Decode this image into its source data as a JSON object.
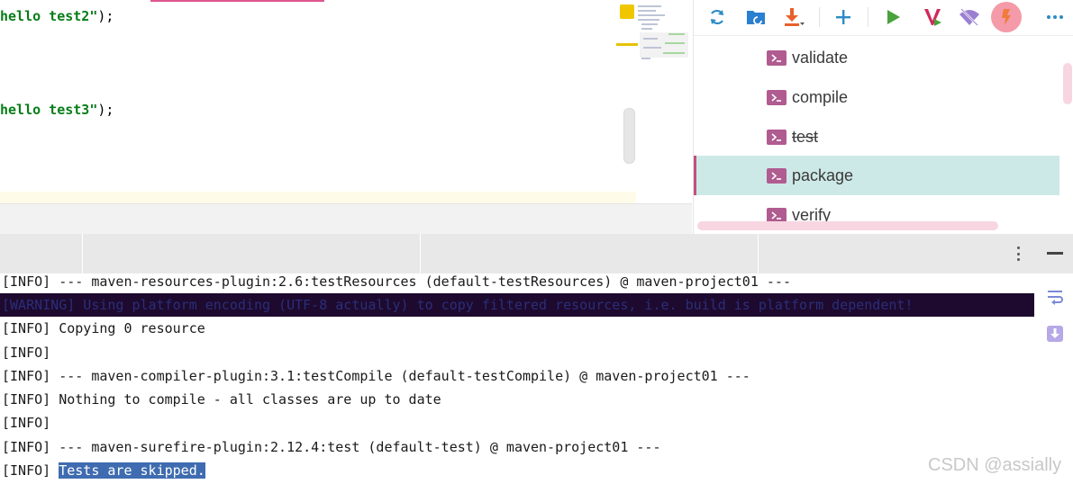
{
  "editor": {
    "lines": [
      {
        "string": "hello test2\"",
        "rest": ");"
      },
      {
        "string": "hello test3\"",
        "rest": ");"
      }
    ]
  },
  "maven": {
    "toolbar": {
      "reload": "reload-icon",
      "generate_sources": "folder-sync-icon",
      "download": "download-icon",
      "add": "plus-icon",
      "run": "play-icon",
      "execute_goal": "maven-v-icon",
      "offline": "wifi-off-icon",
      "skip_tests": "lightning-icon",
      "more": "more-horizontal-icon"
    },
    "goals": [
      {
        "label": "validate",
        "strike": false,
        "selected": false
      },
      {
        "label": "compile",
        "strike": false,
        "selected": false
      },
      {
        "label": "test",
        "strike": true,
        "selected": false
      },
      {
        "label": "package",
        "strike": false,
        "selected": true
      },
      {
        "label": "verify",
        "strike": false,
        "selected": false
      }
    ]
  },
  "console": {
    "lines": [
      "[INFO] --- maven-resources-plugin:2.6:testResources (default-testResources) @ maven-project01 ---",
      "[WARNING] Using platform encoding (UTF-8 actually) to copy filtered resources, i.e. build is platform dependent!",
      "[INFO] Copying 0 resource",
      "[INFO]",
      "[INFO] --- maven-compiler-plugin:3.1:testCompile (default-testCompile) @ maven-project01 ---",
      "[INFO] Nothing to compile - all classes are up to date",
      "[INFO]",
      "[INFO] --- maven-surefire-plugin:2.12.4:test (default-test) @ maven-project01 ---"
    ],
    "last_prefix": "[INFO] ",
    "last_selected": "Tests are skipped."
  },
  "watermark": "CSDN @assially",
  "colors": {
    "accent_pink": "#e0578f",
    "selected_row": "#cde9e7",
    "goal_icon": "#b05c90",
    "selection_blue": "#3f6cb0",
    "warning_band": "#1e0a2e"
  }
}
